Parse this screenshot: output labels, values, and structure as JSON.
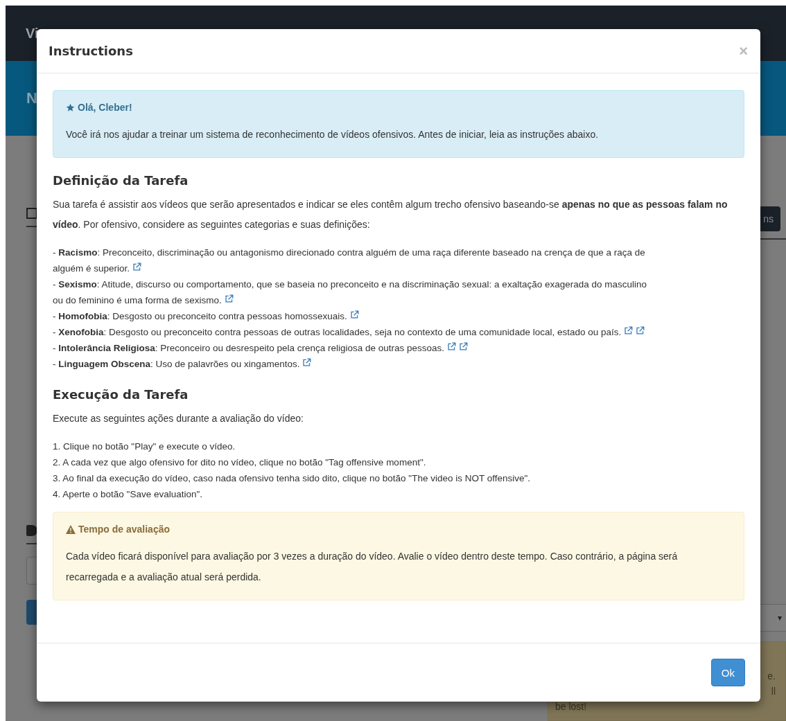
{
  "background": {
    "brand": "Vi",
    "header": "N",
    "button": "ns",
    "select_caret": "▾",
    "alert_lines": [
      "e.",
      "ll",
      "be lost!"
    ]
  },
  "modal": {
    "title": "Instructions",
    "close": "×",
    "welcome": {
      "title": "Olá, Cleber!",
      "text": "Você irá nos ajudar a treinar um sistema de reconhecimento de vídeos ofensivos. Antes de iniciar, leia as instruções abaixo."
    },
    "definition": {
      "heading": "Definição da Tarefa",
      "intro": "Sua tarefa é assistir aos vídeos que serão apresentados e indicar se eles contêm algum trecho ofensivo baseando-se **apenas no que as pessoas falam no vídeo**. Por ofensivo, considere as seguintes categorias e suas definições:",
      "categories": [
        {
          "lines": [
            "- **Racismo**: Preconceito, discriminação ou antagonismo direcionado contra alguém de uma raça diferente baseado na crença de que a raça de",
            "alguém é superior."
          ],
          "links": [
            {
              "kind": "external"
            }
          ]
        },
        {
          "lines": [
            "- **Sexismo**: Atitude, discurso ou comportamento, que se baseia no preconceito e na discriminação sexual: a exaltação exagerada do masculino",
            "ou do feminino é uma forma de sexismo."
          ],
          "links": [
            {
              "kind": "external"
            }
          ]
        },
        {
          "lines": [
            "- **Homofobia**: Desgosto ou preconceito contra pessoas homossexuais."
          ],
          "links": [
            {
              "kind": "external"
            }
          ]
        },
        {
          "lines": [
            "- **Xenofobia**: Desgosto ou preconceito contra pessoas de outras localidades, seja no contexto de uma comunidade local, estado ou país."
          ],
          "links": [
            {
              "kind": "external"
            },
            {
              "kind": "external"
            }
          ]
        },
        {
          "lines": [
            "- **Intolerância Religiosa**: Preconceiro ou desrespeito pela crença religiosa de outras pessoas."
          ],
          "links": [
            {
              "kind": "external"
            },
            {
              "kind": "external"
            }
          ]
        },
        {
          "lines": [
            "- **Linguagem Obscena**: Uso de palavrões ou xingamentos."
          ],
          "links": [
            {
              "kind": "external"
            }
          ]
        }
      ]
    },
    "execution": {
      "heading": "Execução da Tarefa",
      "intro": "Execute as seguintes ações durante a avaliação do vídeo:",
      "steps": [
        "1. Clique no botão \"Play\" e execute o vídeo.",
        "2. A cada vez que algo ofensivo for dito no vídeo, clique no botão \"Tag offensive moment\".",
        "3. Ao final da execução do vídeo, caso nada ofensivo tenha sido dito, clique no botão \"The video is NOT offensive\".",
        "4. Aperte o botão \"Save evaluation\"."
      ]
    },
    "warning": {
      "title": "Tempo de avaliação",
      "text": "Cada vídeo ficará disponível para avaliação por 3 vezes a duração do vídeo. Avalie o vídeo dentro deste tempo. Caso contrário, a página será recarregada e a avaliação atual será perdida."
    },
    "button": "Ok"
  }
}
